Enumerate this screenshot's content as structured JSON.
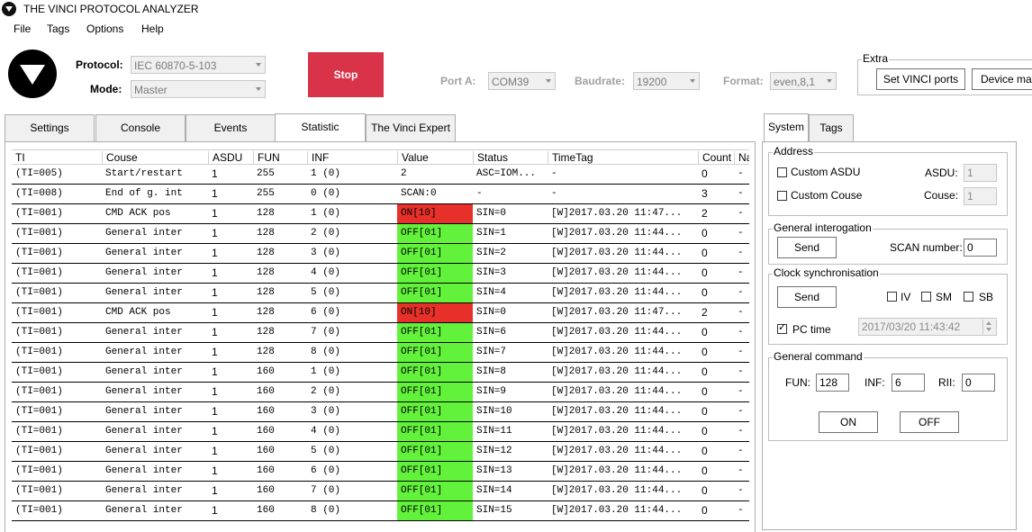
{
  "window": {
    "title": "THE VINCI PROTOCOL ANALYZER"
  },
  "menu": [
    "File",
    "Tags",
    "Options",
    "Help"
  ],
  "controls": {
    "protocol_label": "Protocol:",
    "protocol_value": "IEC 60870-5-103",
    "mode_label": "Mode:",
    "mode_value": "Master",
    "stop_label": "Stop",
    "port_label": "Port A:",
    "port_value": "COM39",
    "baud_label": "Baudrate:",
    "baud_value": "19200",
    "format_label": "Format:",
    "format_value": "even,8,1"
  },
  "extra": {
    "title": "Extra",
    "set_ports": "Set VINCI ports",
    "device_man": "Device man"
  },
  "tabs": [
    "Settings",
    "Console",
    "Events",
    "Statistic",
    "The Vinci Expert"
  ],
  "active_tab": "Statistic",
  "table": {
    "headers": [
      "TI",
      "Couse",
      "ASDU",
      "FUN",
      "INF",
      "Value",
      "Status",
      "TimeTag",
      "Count",
      "Na"
    ],
    "rows": [
      [
        "(TI=005)",
        "Start/restart",
        "1",
        "255",
        "1 (0)",
        "2",
        "ASC=IOM...",
        "-",
        "0",
        "-"
      ],
      [
        "(TI=008)",
        "End of g. int",
        "1",
        "255",
        "0 (0)",
        "SCAN:0",
        "-",
        "-",
        "3",
        "-"
      ],
      [
        "(TI=001)",
        "CMD ACK pos",
        "1",
        "128",
        "1 (0)",
        "ON[10]",
        "SIN=0",
        "[W]2017.03.20 11:47...",
        "2",
        "-"
      ],
      [
        "(TI=001)",
        "General inter",
        "1",
        "128",
        "2 (0)",
        "OFF[01]",
        "SIN=1",
        "[W]2017.03.20 11:44...",
        "0",
        "-"
      ],
      [
        "(TI=001)",
        "General inter",
        "1",
        "128",
        "3 (0)",
        "OFF[01]",
        "SIN=2",
        "[W]2017.03.20 11:44...",
        "0",
        "-"
      ],
      [
        "(TI=001)",
        "General inter",
        "1",
        "128",
        "4 (0)",
        "OFF[01]",
        "SIN=3",
        "[W]2017.03.20 11:44...",
        "0",
        "-"
      ],
      [
        "(TI=001)",
        "General inter",
        "1",
        "128",
        "5 (0)",
        "OFF[01]",
        "SIN=4",
        "[W]2017.03.20 11:44...",
        "0",
        "-"
      ],
      [
        "(TI=001)",
        "CMD ACK pos",
        "1",
        "128",
        "6 (0)",
        "ON[10]",
        "SIN=0",
        "[W]2017.03.20 11:47...",
        "2",
        "-"
      ],
      [
        "(TI=001)",
        "General inter",
        "1",
        "128",
        "7 (0)",
        "OFF[01]",
        "SIN=6",
        "[W]2017.03.20 11:44...",
        "0",
        "-"
      ],
      [
        "(TI=001)",
        "General inter",
        "1",
        "128",
        "8 (0)",
        "OFF[01]",
        "SIN=7",
        "[W]2017.03.20 11:44...",
        "0",
        "-"
      ],
      [
        "(TI=001)",
        "General inter",
        "1",
        "160",
        "1 (0)",
        "OFF[01]",
        "SIN=8",
        "[W]2017.03.20 11:44...",
        "0",
        "-"
      ],
      [
        "(TI=001)",
        "General inter",
        "1",
        "160",
        "2 (0)",
        "OFF[01]",
        "SIN=9",
        "[W]2017.03.20 11:44...",
        "0",
        "-"
      ],
      [
        "(TI=001)",
        "General inter",
        "1",
        "160",
        "3 (0)",
        "OFF[01]",
        "SIN=10",
        "[W]2017.03.20 11:44...",
        "0",
        "-"
      ],
      [
        "(TI=001)",
        "General inter",
        "1",
        "160",
        "4 (0)",
        "OFF[01]",
        "SIN=11",
        "[W]2017.03.20 11:44...",
        "0",
        "-"
      ],
      [
        "(TI=001)",
        "General inter",
        "1",
        "160",
        "5 (0)",
        "OFF[01]",
        "SIN=12",
        "[W]2017.03.20 11:44...",
        "0",
        "-"
      ],
      [
        "(TI=001)",
        "General inter",
        "1",
        "160",
        "6 (0)",
        "OFF[01]",
        "SIN=13",
        "[W]2017.03.20 11:44...",
        "0",
        "-"
      ],
      [
        "(TI=001)",
        "General inter",
        "1",
        "160",
        "7 (0)",
        "OFF[01]",
        "SIN=14",
        "[W]2017.03.20 11:44...",
        "0",
        "-"
      ],
      [
        "(TI=001)",
        "General inter",
        "1",
        "160",
        "8 (0)",
        "OFF[01]",
        "SIN=15",
        "[W]2017.03.20 11:44...",
        "0",
        "-"
      ]
    ],
    "value_colors": {
      "on": "#e8302a",
      "off": "#63f23c"
    }
  },
  "right_tabs": [
    "System",
    "Tags"
  ],
  "address": {
    "title": "Address",
    "custom_asdu": "Custom ASDU",
    "custom_couse": "Custom Couse",
    "asdu_label": "ASDU:",
    "asdu_value": "1",
    "couse_label": "Couse:",
    "couse_value": "1"
  },
  "general_interrogation": {
    "title": "General interogation",
    "send": "Send",
    "scan_label": "SCAN number:",
    "scan_value": "0"
  },
  "clock": {
    "title": "Clock synchronisation",
    "send": "Send",
    "iv": "IV",
    "sm": "SM",
    "sb": "SB",
    "pc_time": "PC time",
    "datetime": "2017/03/20 11:43:42"
  },
  "general_command": {
    "title": "General command",
    "fun_label": "FUN:",
    "fun_value": "128",
    "inf_label": "INF:",
    "inf_value": "6",
    "rii_label": "RII:",
    "rii_value": "0",
    "on": "ON",
    "off": "OFF"
  }
}
